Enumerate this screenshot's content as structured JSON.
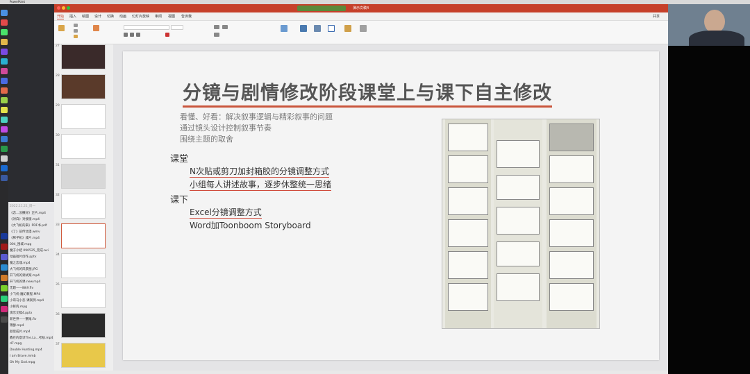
{
  "menubar": {
    "app": "PowerPoint"
  },
  "window": {
    "title": "演示文稿4"
  },
  "tabs": [
    "开始",
    "插入",
    "绘图",
    "设计",
    "切换",
    "动画",
    "幻灯片放映",
    "审阅",
    "视图",
    "告诉我"
  ],
  "share_label": "共享",
  "slide_numbers": [
    "27",
    "28",
    "29",
    "30",
    "31",
    "32",
    "33",
    "34",
    "35",
    "36",
    "37"
  ],
  "slide": {
    "title": "分镜与剧情修改阶段课堂上与课下自主修改",
    "subtitle_lines": [
      "看懂、好看：解决叙事逻辑与精彩叙事的问题",
      "通过镜头设计控制叙事节奏",
      "围绕主题的取舍"
    ],
    "sections": [
      {
        "heading": "课堂",
        "items": [
          "N次贴或剪刀加封箱胶的分镜调整方式",
          "小组每人讲述故事，逐步休整统一思绪"
        ]
      },
      {
        "heading": "课下",
        "items": [
          "Excel分镜调整方式",
          "Word加Toonboom Storyboard"
        ]
      }
    ]
  },
  "desktop_files": [
    "《恋…没撒好》正片.mp4",
    "《对白》对接版.mp4",
    "《大飞机的来》PDF书.pdf",
    "《了》前传动漫.wmv",
    "《稀子机》成片.mp4",
    "004_围城.mpg",
    "魔子小结 090525_完成.avi",
    "动画短片创作.pptx",
    "魔之恋魂.mp4",
    "大飞机的风景图.JPG",
    "开飞机的调试案.mp4",
    "开飞机的课.new.mp4",
    "无题——8&9.flv",
    "小飞机-魔幻教程.MP4",
    "小哥马小恋-课案例.mp4",
    "小鲜肉.mpg",
    "演示文稿4.pptx",
    "新世界——蟹尾.flv",
    "锦瑟.mp4",
    "颜思成片.mp4",
    "鑫在的意识The.La...考核.mp4",
    "d7.mpg",
    "Double Hunting.mp4",
    "I am Brave.mmb",
    "Oh My God.mpg"
  ],
  "desktop_date": "2022.11.21_周一",
  "colors": {
    "titlebar": "#c6402a",
    "accent_underline": "#d04a3a",
    "selected_thumb": "#d05a3c"
  }
}
